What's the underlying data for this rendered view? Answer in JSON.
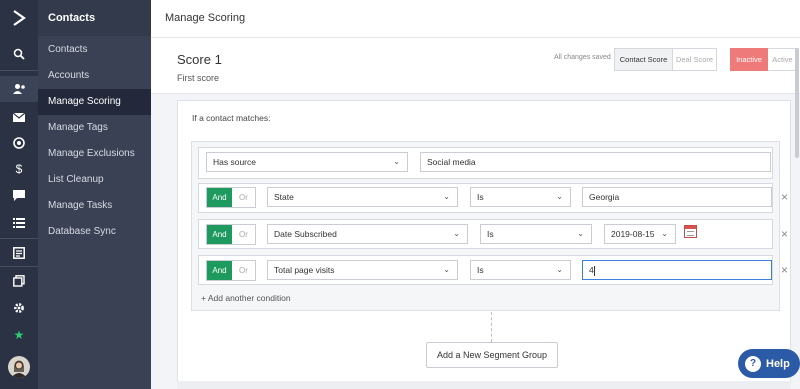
{
  "rail": {
    "icons": [
      "logo-icon",
      "search-icon",
      "contacts-icon",
      "email-icon",
      "target-icon",
      "dollar-icon",
      "chat-icon",
      "list-icon",
      "report-icon",
      "pages-icon",
      "gear-icon",
      "star-icon",
      "avatar"
    ]
  },
  "subnav": {
    "title": "Contacts",
    "items": [
      "Contacts",
      "Accounts",
      "Manage Scoring",
      "Manage Tags",
      "Manage Exclusions",
      "List Cleanup",
      "Manage Tasks",
      "Database Sync"
    ],
    "active": "Manage Scoring"
  },
  "topbar": {
    "title": "Manage Scoring"
  },
  "score": {
    "name": "Score 1",
    "description": "First score",
    "saved_status": "All changes saved",
    "tabs": [
      "Contact Score",
      "Deal Score"
    ],
    "selected_tab": "Contact Score",
    "status_options": [
      "Inactive",
      "Active"
    ],
    "selected_status": "Inactive"
  },
  "panel": {
    "matches_label": "If a contact matches:"
  },
  "conditions": [
    {
      "field": "Has source",
      "value": "Social media"
    },
    {
      "logic": [
        "And",
        "Or"
      ],
      "field": "State",
      "operator": "Is",
      "value": "Georgia"
    },
    {
      "logic": [
        "And",
        "Or"
      ],
      "field": "Date Subscribed",
      "operator": "Is",
      "value": "2019-08-15"
    },
    {
      "logic": [
        "And",
        "Or"
      ],
      "field": "Total page visits",
      "operator": "Is",
      "value": "4"
    }
  ],
  "add_condition_label": "+ Add another condition",
  "add_group_label": "Add a New Segment Group",
  "help_label": "Help",
  "colors": {
    "and_green": "#1f9a5e",
    "inactive_red": "#ef7a7a",
    "help_blue": "#2b5aa6",
    "nav_dark": "#2b3244"
  }
}
